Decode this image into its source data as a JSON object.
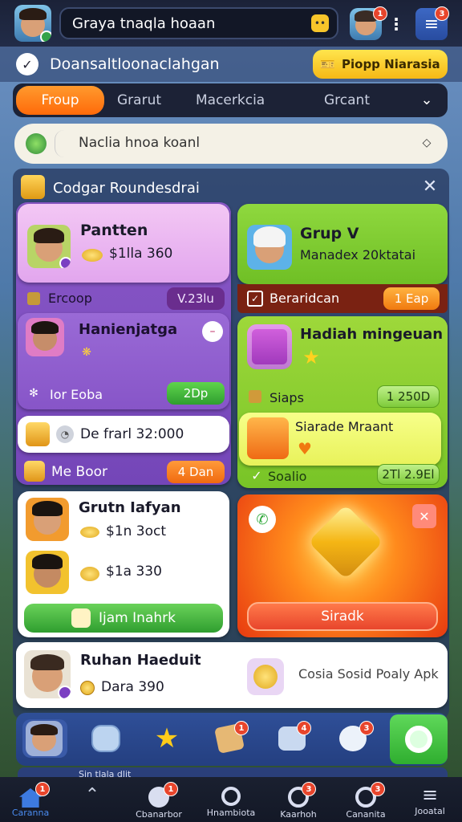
{
  "topbar": {
    "search_text": "Graya tnaqla hoaan",
    "notif_count": "1",
    "menu_count": "3"
  },
  "subheader": {
    "title": "Doansaltloonaclahgan",
    "action_label": "Piopp Niarasia"
  },
  "tabs": [
    {
      "label": "Froup",
      "active": true
    },
    {
      "label": "Grarut",
      "active": false
    },
    {
      "label": "Macerkcia",
      "active": false
    },
    {
      "label": "Grcant",
      "active": false
    }
  ],
  "filter": {
    "text": "Naclia hnoa koanl"
  },
  "panel": {
    "title": "Codgar Roundesdrai",
    "left": {
      "top_card": {
        "name": "Pantten",
        "value": "$1lla 360"
      },
      "row1": {
        "label": "Ercoop",
        "badge": "V.23lu"
      },
      "player": {
        "name": "Hanienjatga"
      },
      "row2": {
        "label": "Ior Eoba",
        "badge": "2Dp"
      },
      "offer": {
        "text": "De frarl 32:000"
      },
      "row3": {
        "label": "Me Boor",
        "badge": "4 Dan"
      },
      "list": [
        {
          "name": "Grutn Iafyan",
          "value": "$1n 3oct"
        },
        {
          "name": "",
          "value": "$1a 330"
        }
      ],
      "cta": "Ijam Inahrk"
    },
    "right": {
      "top_card": {
        "name": "Grup V",
        "value": "Manadex 20ktatai"
      },
      "row1": {
        "label": "Beraridcan",
        "badge": "1 Eap"
      },
      "gift": {
        "name": "Hadiah mingeuan"
      },
      "row2": {
        "label": "Siaps",
        "badge": "1 250D"
      },
      "reward": {
        "name": "Siarade Mraant"
      },
      "row3": {
        "label": "Soalio",
        "badge": "2Tl 2.9El"
      },
      "cta": "Siradk"
    }
  },
  "bottom_card": {
    "name": "Ruhan Haeduit",
    "value": "Dara 390",
    "note": "Cosia Sosid Poaly Apk"
  },
  "quick_badges": [
    "1",
    "4",
    "3"
  ],
  "below_text": "Sin tlala dlit",
  "bottom_nav": [
    {
      "label": "Caranna",
      "badge": "1"
    },
    {
      "label": "",
      "badge": ""
    },
    {
      "label": "Cbanarbor",
      "badge": "1"
    },
    {
      "label": "Hnambiota",
      "badge": ""
    },
    {
      "label": "Kaarhoh",
      "badge": "3"
    },
    {
      "label": "Cananita",
      "badge": "3"
    },
    {
      "label": "Jooatal",
      "badge": ""
    }
  ],
  "colors": {
    "accent_orange": "#ff7a12",
    "accent_green": "#3fbf3a",
    "purple_card": "#8e57c9",
    "green_card": "#7ccc2f",
    "reward_red": "#f04a16"
  }
}
